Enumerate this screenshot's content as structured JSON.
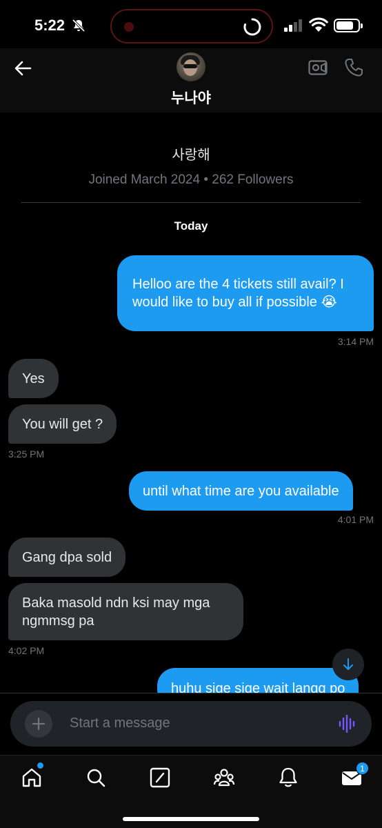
{
  "status_bar": {
    "time": "5:22"
  },
  "header": {
    "name": "누나야"
  },
  "profile": {
    "bio": "사랑해",
    "meta": "Joined March 2024 • 262 Followers"
  },
  "thread": {
    "day_label": "Today",
    "messages": [
      {
        "text": "Helloo are the 4 tickets still avail? I would like to buy all if possible 😭",
        "direction": "outgoing"
      },
      {
        "timestamp": "3:14 PM"
      },
      {
        "text": "Yes",
        "direction": "incoming"
      },
      {
        "text": "You will get ?",
        "direction": "incoming"
      },
      {
        "timestamp": "3:25 PM"
      },
      {
        "text": "until what time are you available",
        "direction": "outgoing"
      },
      {
        "timestamp": "4:01 PM"
      },
      {
        "text": "Gang dpa sold",
        "direction": "incoming"
      },
      {
        "text": "Baka masold ndn ksi may mga ngmmsg pa",
        "direction": "incoming"
      },
      {
        "timestamp": "4:02 PM"
      },
      {
        "text": "huhu sige sige wait langg po",
        "direction": "outgoing"
      }
    ]
  },
  "composer": {
    "placeholder": "Start a message"
  },
  "tabs": {
    "messages_badge": "1"
  },
  "colors": {
    "accent": "#1d9bf0",
    "incoming_bubble": "#2f3336",
    "background": "#000000"
  }
}
